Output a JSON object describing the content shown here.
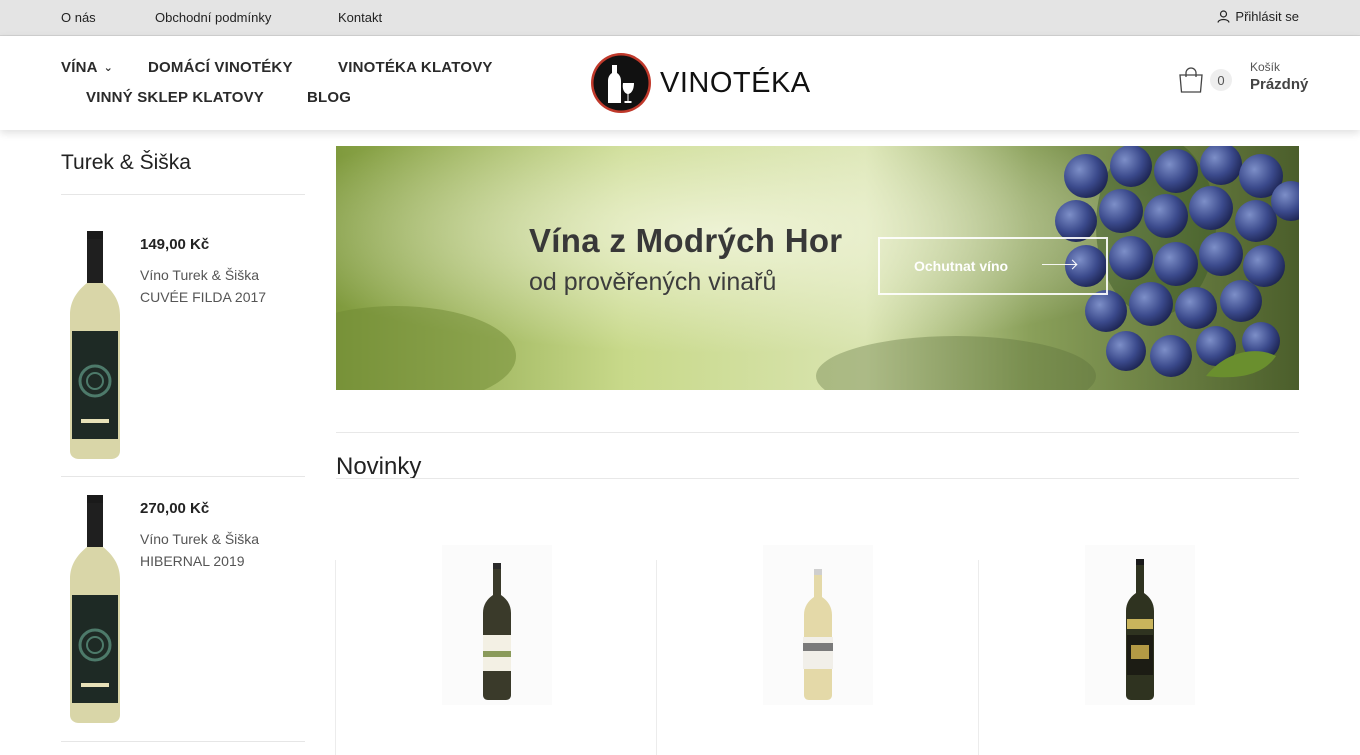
{
  "topbar": {
    "links": [
      "O nás",
      "Obchodní podmínky",
      "Kontakt"
    ],
    "login": "Přihlásit se"
  },
  "nav": {
    "items": [
      "VÍNA",
      "DOMÁCÍ VINOTÉKY",
      "VINOTÉKA KLATOVY",
      "VINNÝ SKLEP KLATOVY",
      "BLOG"
    ]
  },
  "logo": {
    "text": "VINOTÉKA"
  },
  "cart": {
    "count": "0",
    "label": "Košík",
    "status": "Prázdný"
  },
  "sidebar": {
    "title": "Turek & Šiška",
    "products": [
      {
        "price": "149,00 Kč",
        "name": "Víno Turek & Šiška CUVÉE FILDA 2017"
      },
      {
        "price": "270,00 Kč",
        "name": "Víno Turek & Šiška HIBERNAL 2019"
      }
    ]
  },
  "banner": {
    "heading": "Vína z Modrých Hor",
    "subheading": "od prověřených vinařů",
    "button": "Ochutnat víno"
  },
  "novinky": {
    "title": "Novinky"
  },
  "colors": {
    "accent": "#c0392b",
    "topbar": "#e4e4e4",
    "text": "#222222"
  }
}
